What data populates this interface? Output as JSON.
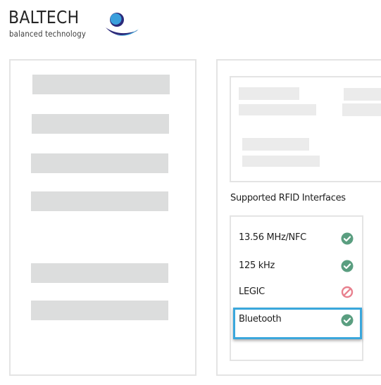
{
  "logo": {
    "brand": "BALTECH",
    "tagline": "balanced technology",
    "colors": {
      "circle": "#3a9fdc",
      "ring": "#2c2a7a",
      "swoosh_dark": "#2c2a7a",
      "swoosh_light": "#3aa7dc"
    }
  },
  "rfid": {
    "title": "Supported RFID Interfaces",
    "interfaces": [
      {
        "label": "13.56 MHz/NFC",
        "status": "supported",
        "icon": "check-circle-icon"
      },
      {
        "label": "125 kHz",
        "status": "supported",
        "icon": "check-circle-icon"
      },
      {
        "label": "LEGIC",
        "status": "not-supported",
        "icon": "prohibited-icon"
      },
      {
        "label": "Bluetooth",
        "status": "supported",
        "icon": "check-circle-icon",
        "highlighted": true
      }
    ]
  },
  "colors": {
    "supported": "#5a9e80",
    "not_supported": "#e8808e",
    "highlight": "#3aa7dc",
    "placeholder": "#dcdddd",
    "placeholder_light": "#ebebeb"
  }
}
